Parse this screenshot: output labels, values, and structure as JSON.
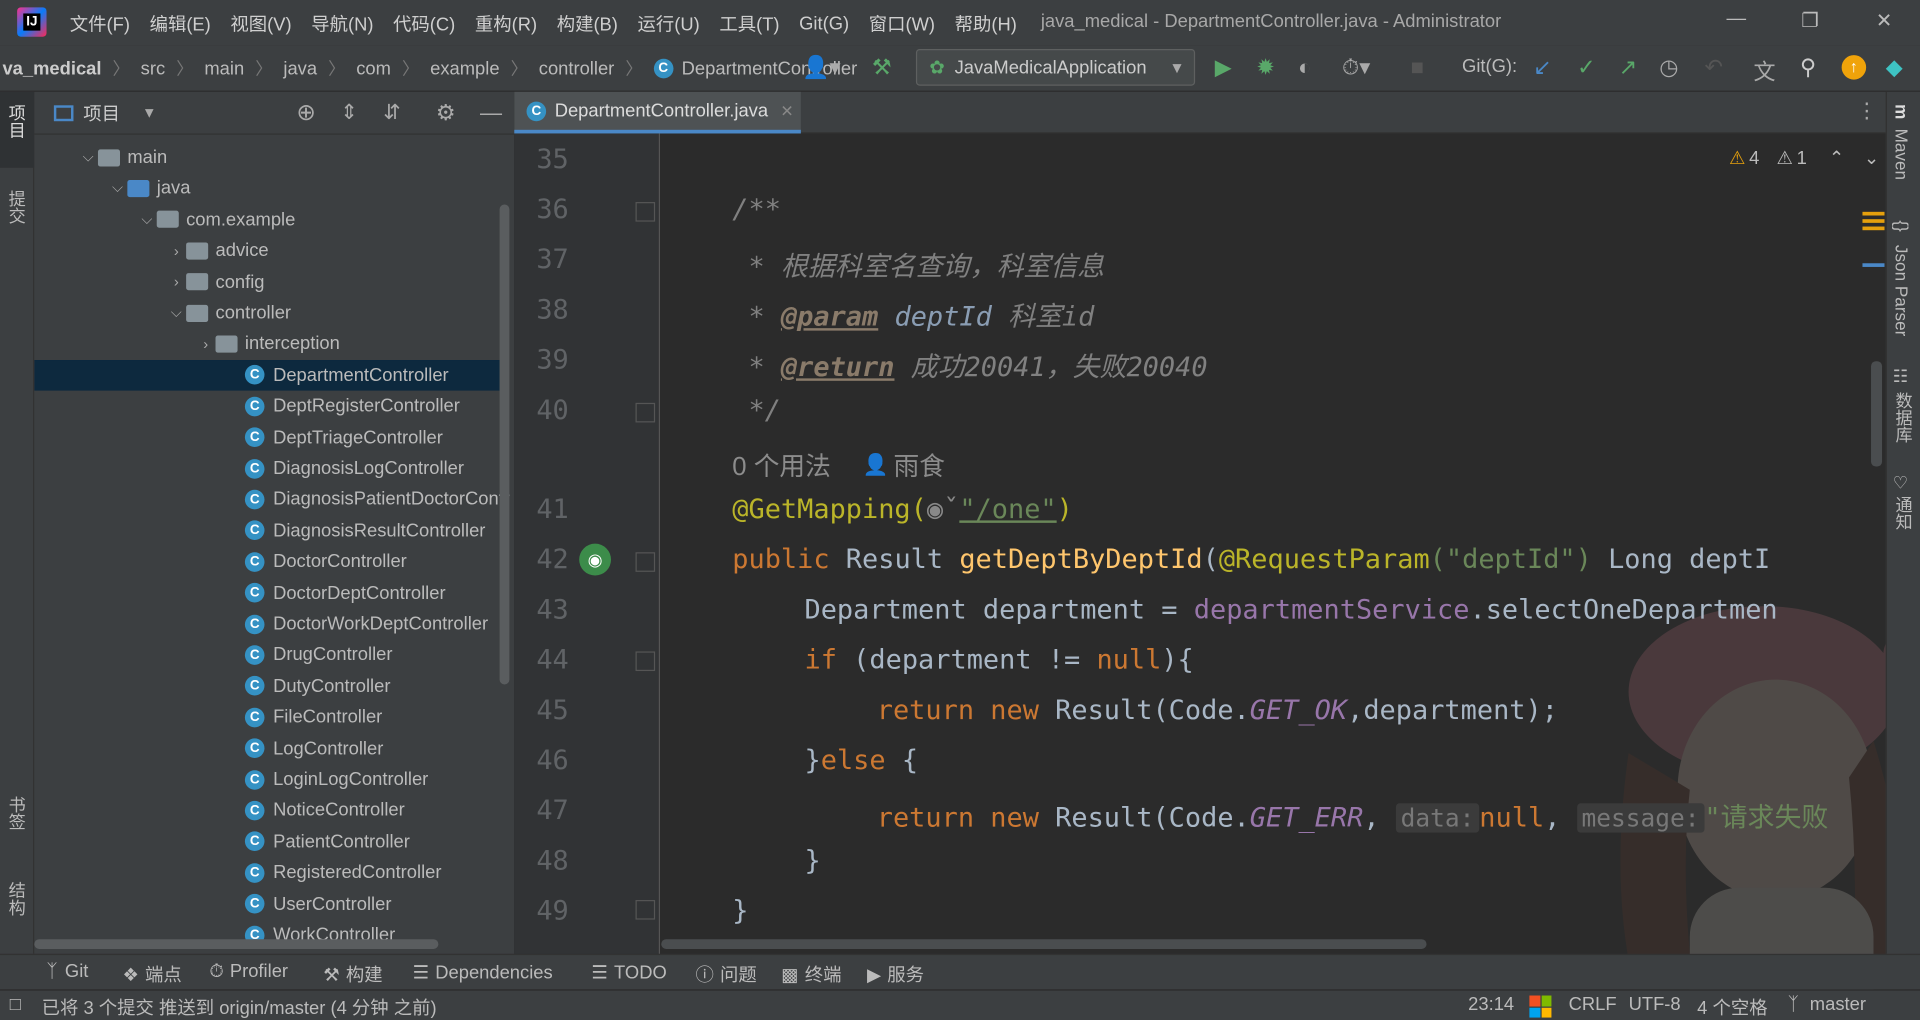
{
  "app": {
    "logo": "IJ",
    "window_title": "java_medical - DepartmentController.java - Administrator"
  },
  "menu": [
    "文件(F)",
    "编辑(E)",
    "视图(V)",
    "导航(N)",
    "代码(C)",
    "重构(R)",
    "构建(B)",
    "运行(U)",
    "工具(T)",
    "Git(G)",
    "窗口(W)",
    "帮助(H)"
  ],
  "breadcrumb": [
    "va_medical",
    "src",
    "main",
    "java",
    "com",
    "example",
    "controller",
    "DepartmentController"
  ],
  "toolbar": {
    "run_config": "JavaMedicalApplication",
    "git_label": "Git(G):"
  },
  "left_strip": {
    "project": "项目",
    "commit": "提交",
    "bookmarks": "书签",
    "structure": "结构"
  },
  "right_strip": {
    "maven": "Maven",
    "json_parser": "Json Parser",
    "database": "数据库",
    "notifications": "通知"
  },
  "project_panel": {
    "title": "项目"
  },
  "tree": [
    {
      "label": "main",
      "type": "folder"
    },
    {
      "label": "java",
      "type": "folder-blue"
    },
    {
      "label": "com.example",
      "type": "package"
    },
    {
      "label": "advice",
      "type": "package"
    },
    {
      "label": "config",
      "type": "package"
    },
    {
      "label": "controller",
      "type": "package"
    },
    {
      "label": "interception",
      "type": "package"
    },
    {
      "label": "DepartmentController",
      "type": "class"
    },
    {
      "label": "DeptRegisterController",
      "type": "class"
    },
    {
      "label": "DeptTriageController",
      "type": "class"
    },
    {
      "label": "DiagnosisLogController",
      "type": "class"
    },
    {
      "label": "DiagnosisPatientDoctorContr",
      "type": "class"
    },
    {
      "label": "DiagnosisResultController",
      "type": "class"
    },
    {
      "label": "DoctorController",
      "type": "class"
    },
    {
      "label": "DoctorDeptController",
      "type": "class"
    },
    {
      "label": "DoctorWorkDeptController",
      "type": "class"
    },
    {
      "label": "DrugController",
      "type": "class"
    },
    {
      "label": "DutyController",
      "type": "class"
    },
    {
      "label": "FileController",
      "type": "class"
    },
    {
      "label": "LogController",
      "type": "class"
    },
    {
      "label": "LoginLogController",
      "type": "class"
    },
    {
      "label": "NoticeController",
      "type": "class"
    },
    {
      "label": "PatientController",
      "type": "class"
    },
    {
      "label": "RegisteredController",
      "type": "class"
    },
    {
      "label": "UserController",
      "type": "class"
    },
    {
      "label": "WorkController",
      "type": "class"
    }
  ],
  "editor": {
    "tab": "DepartmentController.java",
    "warnings": "4",
    "weak_warnings": "1",
    "line_numbers": [
      "35",
      "36",
      "37",
      "38",
      "39",
      "40",
      "41",
      "42",
      "43",
      "44",
      "45",
      "46",
      "47",
      "48",
      "49"
    ],
    "usage_hint": "0 个用法",
    "author_hint": "雨食",
    "lines": {
      "l36": "/**",
      "l37a": " * ",
      "l37b": "根据科室名查询，科室信息",
      "l38a": " * ",
      "l38tag": "@param",
      "l38b": " deptId ",
      "l38c": "科室id",
      "l39a": " * ",
      "l39tag": "@return",
      "l39b": " 成功20041，失败20040",
      "l40": " */",
      "l41a": "@GetMapping(",
      "l41b": "\"/one\"",
      "l41c": ")",
      "l42a": "public ",
      "l42b": "Result ",
      "l42c": "getDeptByDeptId",
      "l42d": "(",
      "l42e": "@RequestParam",
      "l42f": "(\"deptId\")",
      "l42g": " Long deptI",
      "l43a": "Department department = ",
      "l43b": "departmentService",
      "l43c": ".selectOneDepartmen",
      "l44a": "if ",
      "l44b": "(department != ",
      "l44c": "null",
      "l44d": "){",
      "l45a": "return new ",
      "l45b": "Result(Code.",
      "l45c": "GET_OK",
      "l45d": ",department);",
      "l46a": "}",
      "l46b": "else ",
      "l46c": "{",
      "l47a": "return new ",
      "l47b": "Result(Code.",
      "l47c": "GET_ERR",
      "l47hint1": "data:",
      "l47null": "null",
      "l47hint2": "message:",
      "l47str": "\"请求失败",
      "l48": "}",
      "l49": "}"
    }
  },
  "bottom_tools": [
    "Git",
    "端点",
    "Profiler",
    "构建",
    "Dependencies",
    "TODO",
    "问题",
    "终端",
    "服务"
  ],
  "status": {
    "message": "已将 3 个提交 推送到 origin/master (4 分钟 之前)",
    "position": "23:14",
    "line_sep": "CRLF",
    "encoding": "UTF-8",
    "indent": "4 个空格",
    "branch": "master"
  }
}
